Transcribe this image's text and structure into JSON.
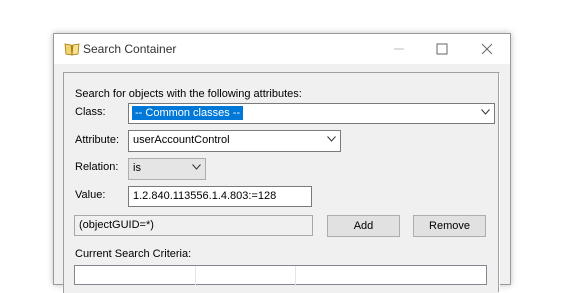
{
  "window": {
    "title": "Search Container",
    "app_icon": "open-book-icon",
    "controls": {
      "minimize": "minimize-icon",
      "maximize": "maximize-icon",
      "close": "close-icon"
    }
  },
  "form": {
    "heading": "Search for objects with the following attributes:",
    "class_label": "Class:",
    "class_value": "-- Common classes --",
    "attribute_label": "Attribute:",
    "attribute_value": "userAccountControl",
    "relation_label": "Relation:",
    "relation_value": "is",
    "value_label": "Value:",
    "value_value": "1.2.840.113556.1.4.803:=128",
    "filter_value": "(objectGUID=*)",
    "add_label": "Add",
    "remove_label": "Remove",
    "criteria_label": "Current Search Criteria:"
  },
  "colors": {
    "selection": "#0078d7",
    "dialog_bg": "#f0f0f0"
  }
}
